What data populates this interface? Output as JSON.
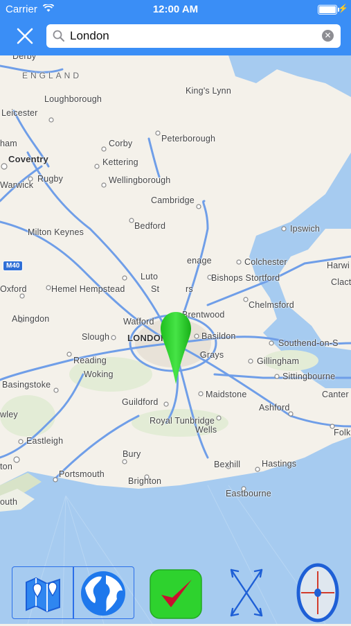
{
  "status": {
    "carrier": "Carrier",
    "time": "12:00 AM"
  },
  "search": {
    "value": "London"
  },
  "map": {
    "places": [
      {
        "label": "Derby"
      },
      {
        "label": "ENGLAND"
      },
      {
        "label": "King's Lynn"
      },
      {
        "label": "Loughborough"
      },
      {
        "label": "Leicester"
      },
      {
        "label": "Corby"
      },
      {
        "label": "Peterborough"
      },
      {
        "label": "ham"
      },
      {
        "label": "Coventry"
      },
      {
        "label": "Kettering"
      },
      {
        "label": "Warwick"
      },
      {
        "label": "Rugby"
      },
      {
        "label": "Wellingborough"
      },
      {
        "label": "Cambridge"
      },
      {
        "label": "Bedford"
      },
      {
        "label": "Ipswich"
      },
      {
        "label": "Milton Keynes"
      },
      {
        "label": "Colchester"
      },
      {
        "label": "Harwi"
      },
      {
        "label": "Bishops Stortford"
      },
      {
        "label": "Clact"
      },
      {
        "label": "Oxford"
      },
      {
        "label": "Hemel Hempstead"
      },
      {
        "label": "Chelmsford"
      },
      {
        "label": "Abingdon"
      },
      {
        "label": "Watford"
      },
      {
        "label": "Brentwood"
      },
      {
        "label": "Slough"
      },
      {
        "label": "LONDON"
      },
      {
        "label": "Basildon"
      },
      {
        "label": "Southend-on-S"
      },
      {
        "label": "Reading"
      },
      {
        "label": "Grays"
      },
      {
        "label": "Gillingham"
      },
      {
        "label": "Basingstoke"
      },
      {
        "label": "Woking"
      },
      {
        "label": "Sittingbourne"
      },
      {
        "label": "Maidstone"
      },
      {
        "label": "Canter"
      },
      {
        "label": "Guildford"
      },
      {
        "label": "wley"
      },
      {
        "label": "Ashford"
      },
      {
        "label": "Royal Tunbridge"
      },
      {
        "label": "Wells"
      },
      {
        "label": "Folk"
      },
      {
        "label": "Eastleigh"
      },
      {
        "label": "Bury"
      },
      {
        "label": "Bexhill"
      },
      {
        "label": "Hastings"
      },
      {
        "label": "ton"
      },
      {
        "label": "Portsmouth"
      },
      {
        "label": "Brighton"
      },
      {
        "label": "Eastbourne"
      },
      {
        "label": "outh"
      },
      {
        "label": "Luto"
      },
      {
        "label": "St"
      },
      {
        "label": "enage"
      },
      {
        "label": "rs"
      }
    ],
    "road_badge": "M40"
  },
  "toolbar": {
    "buttons": [
      "map-pins",
      "globe",
      "confirm",
      "expand",
      "compass"
    ]
  },
  "colors": {
    "nav": "#3a8ef6",
    "road": "#6f9ee8",
    "pin": "#2dd42d",
    "toolbar_blue": "#2a6ee8",
    "sea": "#a6cbf0"
  }
}
